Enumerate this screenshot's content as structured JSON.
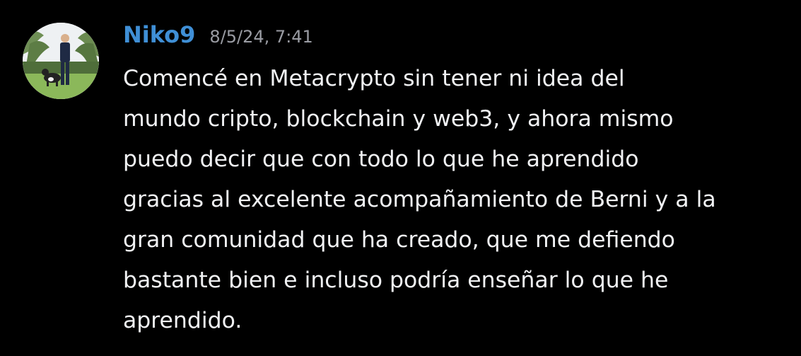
{
  "message": {
    "author": "Niko9",
    "timestamp": "8/5/24, 7:41",
    "avatar_icon": "user-avatar-photo",
    "colors": {
      "background": "#000000",
      "author": "#3f8fd6",
      "timestamp": "#9a9ca3",
      "text": "#f1f2f4"
    },
    "lines": [
      "Comencé en Metacrypto sin tener ni idea del",
      "mundo cripto, blockchain y web3, y ahora mismo",
      "puedo decir que con todo lo que he aprendido",
      "gracias al excelente acompañamiento de Berni y a la",
      "gran comunidad que ha creado, que me defiendo",
      "bastante bien e incluso podría enseñar lo que he",
      "aprendido."
    ]
  }
}
